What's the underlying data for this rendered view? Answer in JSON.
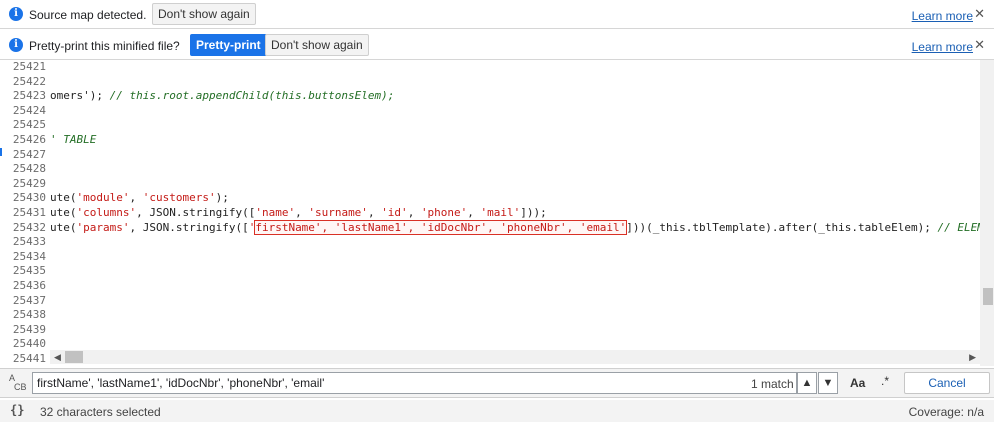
{
  "infobar1": {
    "message": "Source map detected.",
    "dont_show": "Don't show again",
    "learn_more": "Learn more",
    "close": "✕"
  },
  "infobar2": {
    "message": "Pretty-print this minified file?",
    "pretty_print": "Pretty-print",
    "dont_show": "Don't show again",
    "learn_more": "Learn more",
    "close": "✕"
  },
  "editor": {
    "lines": [
      {
        "n": "25421",
        "segments": []
      },
      {
        "n": "25422",
        "segments": []
      },
      {
        "n": "25423",
        "segments": [
          {
            "t": "omers'); ",
            "c": "c-id"
          },
          {
            "t": "// this.root.appendChild(this.buttonsElem);",
            "c": "c-com"
          }
        ]
      },
      {
        "n": "25424",
        "segments": []
      },
      {
        "n": "25425",
        "segments": []
      },
      {
        "n": "25426",
        "segments": [
          {
            "t": "' TABLE",
            "c": "c-com"
          }
        ]
      },
      {
        "n": "25427",
        "segments": []
      },
      {
        "n": "25428",
        "segments": []
      },
      {
        "n": "25429",
        "segments": []
      },
      {
        "n": "25430",
        "segments": [
          {
            "t": "ute(",
            "c": "c-id"
          },
          {
            "t": "'module'",
            "c": "c-str"
          },
          {
            "t": ", ",
            "c": "c-id"
          },
          {
            "t": "'customers'",
            "c": "c-str"
          },
          {
            "t": ");",
            "c": "c-id"
          }
        ]
      },
      {
        "n": "25431",
        "segments": [
          {
            "t": "ute(",
            "c": "c-id"
          },
          {
            "t": "'columns'",
            "c": "c-str"
          },
          {
            "t": ", JSON.stringify([",
            "c": "c-id"
          },
          {
            "t": "'name'",
            "c": "c-str"
          },
          {
            "t": ", ",
            "c": "c-id"
          },
          {
            "t": "'surname'",
            "c": "c-str"
          },
          {
            "t": ", ",
            "c": "c-id"
          },
          {
            "t": "'id'",
            "c": "c-str"
          },
          {
            "t": ", ",
            "c": "c-id"
          },
          {
            "t": "'phone'",
            "c": "c-str"
          },
          {
            "t": ", ",
            "c": "c-id"
          },
          {
            "t": "'mail'",
            "c": "c-str"
          },
          {
            "t": "]));",
            "c": "c-id"
          }
        ]
      },
      {
        "n": "25432",
        "segments": [
          {
            "t": "ute(",
            "c": "c-id"
          },
          {
            "t": "'params'",
            "c": "c-str"
          },
          {
            "t": ", JSON.stringify([",
            "c": "c-id"
          },
          {
            "t": "'",
            "c": "c-str"
          },
          {
            "t": "firstName', 'lastName1', 'idDocNbr', 'phoneNbr', 'email'",
            "c": "c-str match-box"
          },
          {
            "t": "]))(_this.tblTemplate).after(_this.tableElem); ",
            "c": "c-id"
          },
          {
            "t": "// ELEM",
            "c": "c-com"
          }
        ]
      },
      {
        "n": "25433",
        "segments": []
      },
      {
        "n": "25434",
        "segments": []
      },
      {
        "n": "25435",
        "segments": []
      },
      {
        "n": "25436",
        "segments": []
      },
      {
        "n": "25437",
        "segments": []
      },
      {
        "n": "25438",
        "segments": []
      },
      {
        "n": "25439",
        "segments": []
      },
      {
        "n": "25440",
        "segments": []
      },
      {
        "n": "25441",
        "segments": []
      }
    ]
  },
  "search": {
    "replace_icon_top": "A",
    "replace_icon_bottom": "CB",
    "value": "firstName', 'lastName1', 'idDocNbr', 'phoneNbr', 'email'",
    "match_count": "1 match",
    "prev": "▲",
    "next": "▼",
    "match_case": "Aa",
    "regex": ".*",
    "cancel": "Cancel"
  },
  "status": {
    "braces": "{}",
    "selected": "32 characters selected",
    "coverage": "Coverage: n/a"
  }
}
